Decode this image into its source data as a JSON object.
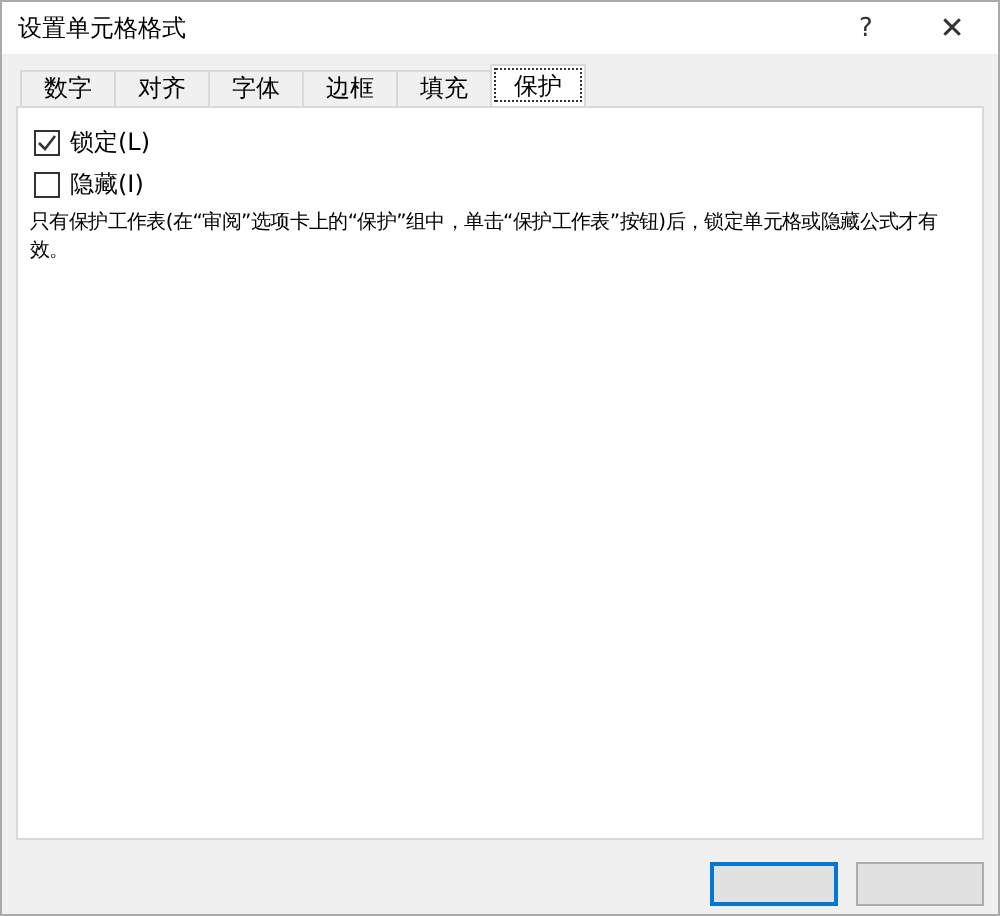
{
  "window": {
    "title": "设置单元格格式",
    "help": "?",
    "close": "✕"
  },
  "tabs": [
    {
      "label": "数字",
      "selected": false
    },
    {
      "label": "对齐",
      "selected": false
    },
    {
      "label": "字体",
      "selected": false
    },
    {
      "label": "边框",
      "selected": false
    },
    {
      "label": "填充",
      "selected": false
    },
    {
      "label": "保护",
      "selected": true
    }
  ],
  "options": [
    {
      "label": "锁定(L)",
      "checked": true
    },
    {
      "label": "隐藏(I)",
      "checked": false
    }
  ],
  "note": "只有保护工作表(在“审阅”选项卡上的“保护”组中，单击“保护工作表”按钮)后，锁定单元格或隐藏公式才有效。",
  "buttons": [
    {
      "default": true
    },
    {
      "default": false
    }
  ]
}
